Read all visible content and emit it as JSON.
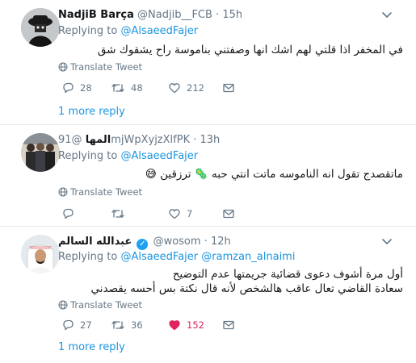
{
  "tweets": [
    {
      "name": "NadjiB Barça",
      "handle": "@Nadjib__FCB",
      "time": "15h",
      "replying_prefix": "Replying to",
      "replying_to": [
        "@AlsaeedFajer"
      ],
      "text": "في المخفر اذا قلتي لهم اشك انها وصفتني بناموسة راح يشقوك شق",
      "translate": "Translate Tweet",
      "replies": "28",
      "retweets": "48",
      "likes": "212",
      "more_replies": "1 more reply"
    },
    {
      "name": "المها",
      "handle": "@91mjWpXyjzXlfPK",
      "time": "13h",
      "replying_prefix": "Replying to",
      "replying_to": [
        "@AlsaeedFajer"
      ],
      "text": "ماتقصدج تقول انه الناموسه ماتت انتي حبه 🦠 ترزقين 😅",
      "translate": "Translate Tweet",
      "replies": "",
      "retweets": "",
      "likes": "7"
    },
    {
      "name": "عبدالله السالم",
      "handle": "@wosom",
      "time": "12h",
      "replying_prefix": "Replying to",
      "replying_to": [
        "@AlsaeedFajer",
        "@ramzan_alnaimi"
      ],
      "text_line1": "أول مرة أشوف دعوى قضائية جريمتها عدم التوضيح",
      "text_line2": "سعادة القاضي تعال عاقب هالشخص لأنه قال نكتة بس أحسه يقصدني",
      "translate": "Translate Tweet",
      "replies": "27",
      "retweets": "36",
      "likes": "152",
      "more_replies": "1 more reply"
    }
  ],
  "colors": {
    "link": "#1b95e0",
    "muted": "#657786",
    "like": "#e0245e",
    "verified": "#1da1f2",
    "divider": "#e6ecf0"
  },
  "icons": {
    "caret": "chevron-down-icon",
    "reply": "reply-icon",
    "retweet": "retweet-icon",
    "like": "heart-icon",
    "dm": "envelope-icon",
    "translate": "globe-icon",
    "verified": "verified-badge-icon"
  }
}
